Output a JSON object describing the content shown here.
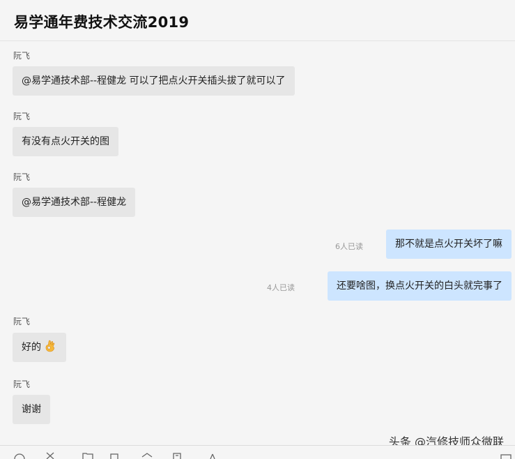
{
  "header": {
    "title": "易学通年费技术交流2019"
  },
  "messages": [
    {
      "sender": "阮飞",
      "text": "@易学通技术部--程健龙 可以了把点火开关插头拔了就可以了"
    },
    {
      "sender": "阮飞",
      "text": "有没有点火开关的图"
    },
    {
      "sender": "阮飞",
      "text": "@易学通技术部--程健龙"
    },
    {
      "read": "6人已读",
      "text": "那不就是点火开关坏了嘛"
    },
    {
      "read": "4人已读",
      "text": "还要啥图，换点火开关的白头就完事了"
    },
    {
      "sender": "阮飞",
      "text": "好的",
      "emoji": "ok-hand-emoji"
    },
    {
      "sender": "阮飞",
      "text": "谢谢"
    }
  ],
  "watermark": "头条 @汽修技师众微联",
  "colors": {
    "incoming_bubble": "#e6e6e6",
    "outgoing_bubble": "#cde5ff",
    "background": "#f5f5f5"
  },
  "toolbar_icons": [
    "emoji-icon",
    "scissors-icon",
    "folder-icon",
    "image-icon",
    "box-icon",
    "history-icon",
    "more-icon",
    "expand-icon"
  ]
}
